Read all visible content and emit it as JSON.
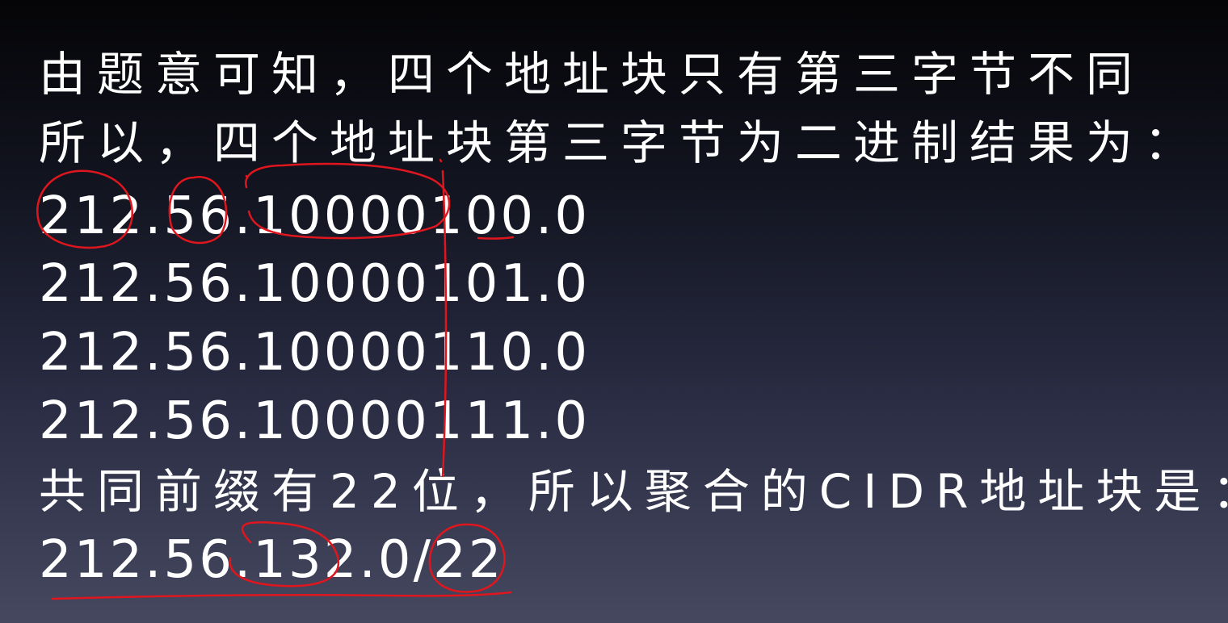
{
  "slide": {
    "line1": "由题意可知，四个地址块只有第三字节不同",
    "line2": "所以，四个地址块第三字节为二进制结果为：",
    "blocks": [
      "212.56.10000100.0",
      "212.56.10000101.0",
      "212.56.10000110.0",
      "212.56.10000111.0"
    ],
    "conclusion": "共同前缀有22位，所以聚合的CIDR地址块是：",
    "result": "212.56.132.0/22"
  },
  "annotation_color": "#e0161e"
}
